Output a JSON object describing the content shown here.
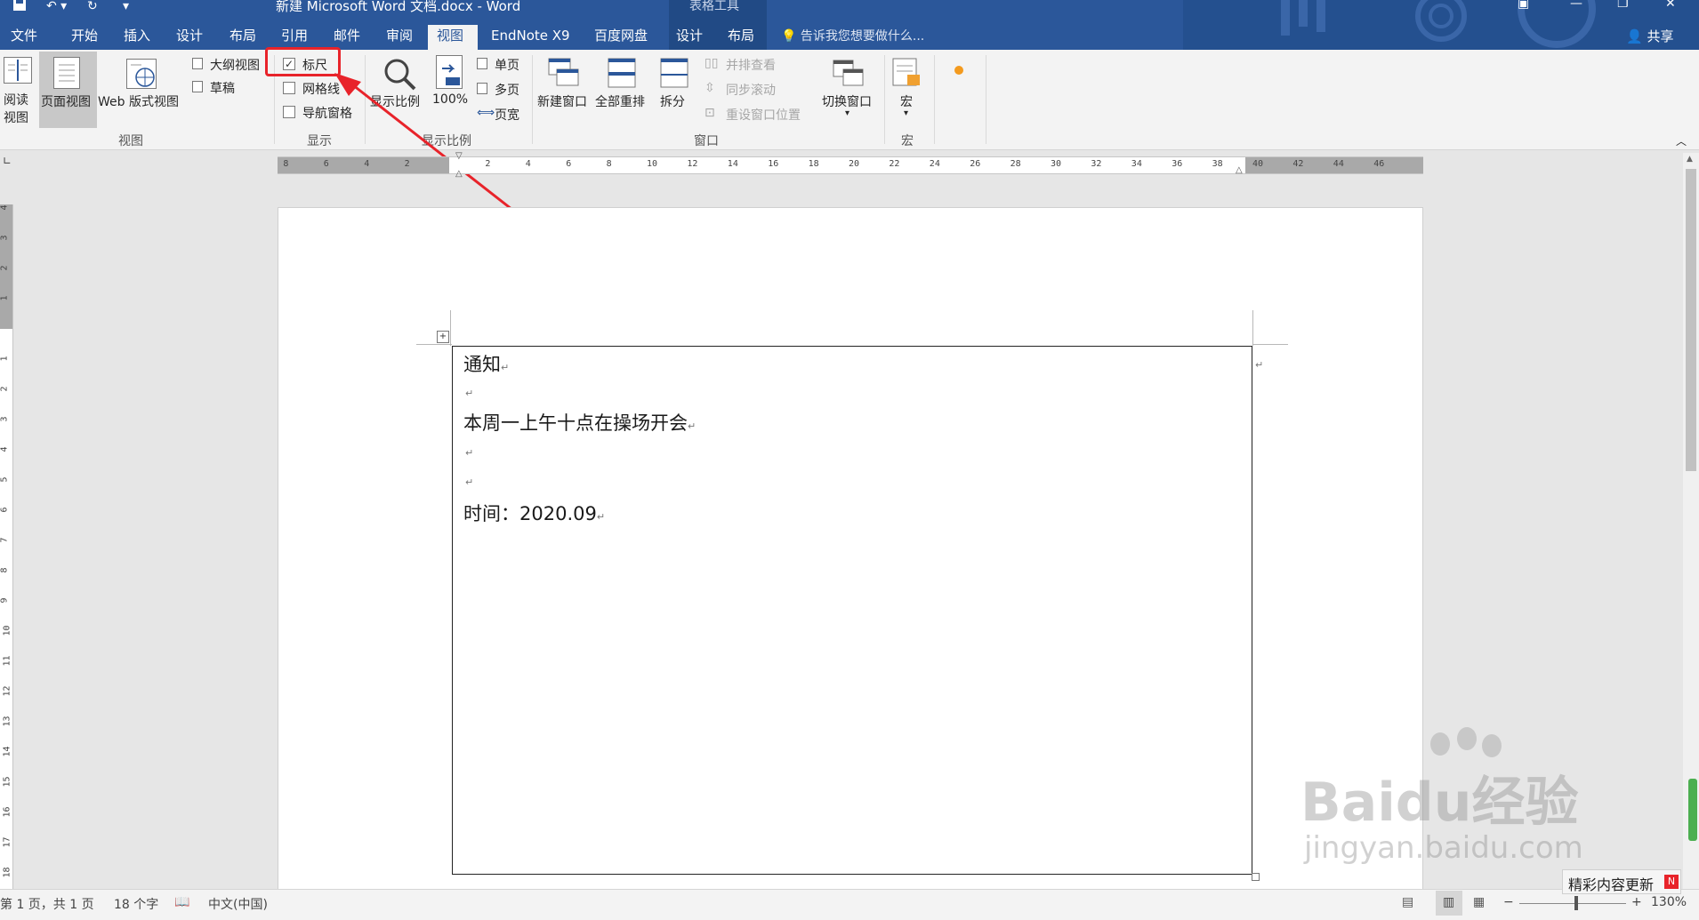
{
  "window": {
    "title": "新建 Microsoft Word 文档.docx - Word",
    "tool_context": "表格工具",
    "quick_access": [
      "save-icon",
      "undo-icon",
      "redo-icon",
      "customize-icon"
    ],
    "window_controls": [
      "ribbon-display-icon",
      "minimize-icon",
      "restore-icon",
      "close-icon"
    ]
  },
  "tabs": [
    {
      "label": "文件"
    },
    {
      "label": "开始"
    },
    {
      "label": "插入"
    },
    {
      "label": "设计"
    },
    {
      "label": "布局"
    },
    {
      "label": "引用"
    },
    {
      "label": "邮件"
    },
    {
      "label": "审阅"
    },
    {
      "label": "视图",
      "active": true
    },
    {
      "label": "EndNote X9"
    },
    {
      "label": "百度网盘"
    },
    {
      "label": "设计"
    },
    {
      "label": "布局"
    }
  ],
  "tell_me": "告诉我您想要做什么...",
  "share": "共享",
  "ribbon": {
    "views": {
      "group_label": "视图",
      "read_mode": "阅读\n视图",
      "read_mode_l1": "阅读",
      "read_mode_l2": "视图",
      "print_layout": "页面视图",
      "web_layout": "Web 版式视图",
      "outline": "大纲视图",
      "draft": "草稿"
    },
    "show": {
      "group_label": "显示",
      "ruler": "标尺",
      "ruler_checked": true,
      "gridlines": "网格线",
      "gridlines_checked": false,
      "nav_pane": "导航窗格",
      "nav_pane_checked": false
    },
    "zoom": {
      "group_label": "显示比例",
      "zoom": "显示比例",
      "hundred": "100%",
      "one_page": "单页",
      "multi_page": "多页",
      "page_width": "页宽"
    },
    "window": {
      "group_label": "窗口",
      "new_window": "新建窗口",
      "arrange_all": "全部重排",
      "split": "拆分",
      "side_by_side": "并排查看",
      "sync_scroll": "同步滚动",
      "reset_position": "重设窗口位置",
      "switch_windows": "切换窗口"
    },
    "macros": {
      "group_label": "宏",
      "macros": "宏"
    }
  },
  "ruler_numbers": [
    "8",
    "6",
    "4",
    "2",
    "2",
    "4",
    "6",
    "8",
    "10",
    "12",
    "14",
    "16",
    "18",
    "20",
    "22",
    "24",
    "26",
    "28",
    "30",
    "32",
    "34",
    "36",
    "38",
    "40",
    "42",
    "44",
    "46"
  ],
  "vruler_numbers": [
    "4",
    "3",
    "2",
    "1",
    "1",
    "2",
    "3",
    "4",
    "5",
    "6",
    "7",
    "8",
    "9",
    "10",
    "11",
    "12",
    "13",
    "14",
    "15",
    "16",
    "17",
    "18"
  ],
  "document": {
    "line1": "通知",
    "line2": "本周一上午十点在操场开会",
    "line3_label": "时间：",
    "line3_value": "2020.09"
  },
  "status": {
    "page": "第 1 页，共 1 页",
    "words": "18 个字",
    "language": "中文(中国)",
    "zoom": "130%"
  },
  "watermark": {
    "brand": "Baidu经验",
    "url": "jingyan.baidu.com",
    "badge": "精彩内容更新"
  },
  "colors": {
    "accent": "#2b579a",
    "highlight": "#e8232a"
  }
}
